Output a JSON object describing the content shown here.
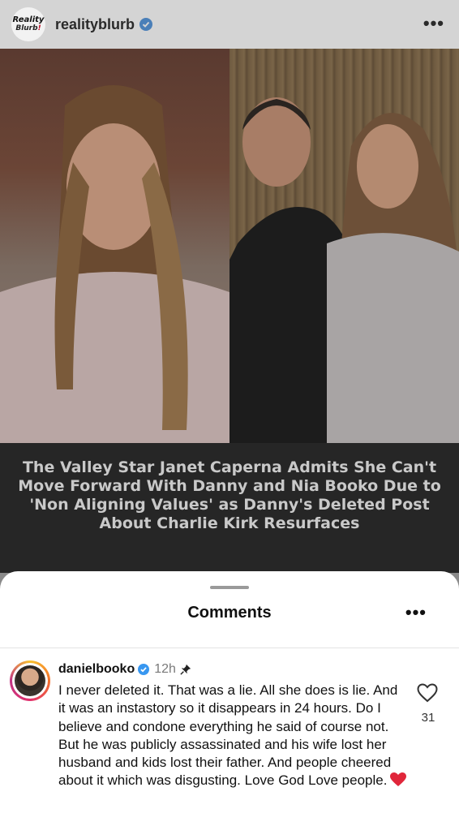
{
  "header": {
    "logo_line1": "Reality",
    "logo_line2": "Blurb",
    "logo_exclaim": "!",
    "username": "realityblurb",
    "more_icon": "more-horizontal-icon"
  },
  "post": {
    "caption": "The Valley Star Janet Caperna Admits She Can't Move Forward With Danny and Nia Booko Due to 'Non Aligning Values' as Danny's Deleted Post About Charlie Kirk Resurfaces"
  },
  "comments_sheet": {
    "title": "Comments",
    "more_icon": "more-horizontal-icon"
  },
  "comment": {
    "username": "danielbooko",
    "time": "12h",
    "pinned": true,
    "text": "I never deleted it. That was a lie. All she does is lie. And it was an instastory so it disappears in 24 hours. Do I believe and condone everything he said of course not. But he was publicly assassinated and his wife lost her husband and kids lost their father. And people cheered about it which was disgusting. Love God Love people.",
    "emoji": "heart-emoji",
    "likes": "31"
  },
  "colors": {
    "verified": "#3897f0",
    "heart_emoji": "#e0263a",
    "sheet_bg": "#ffffff",
    "overlay_dim": "#8a8a8a"
  }
}
